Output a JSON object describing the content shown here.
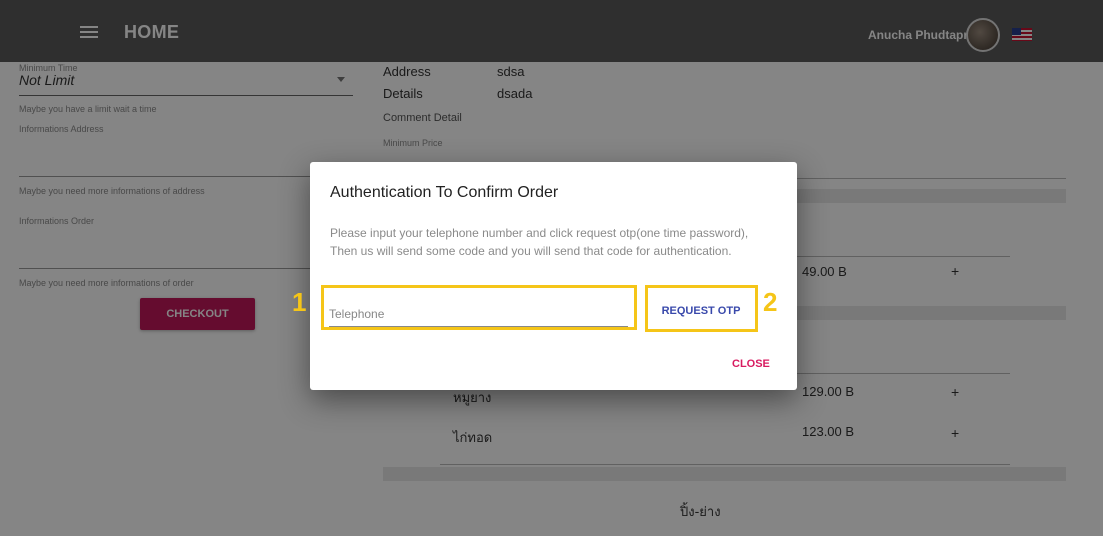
{
  "header": {
    "title": "HOME",
    "user_name": "Anucha Phudtapranee"
  },
  "form": {
    "min_time_label": "Minimum Time",
    "min_time_value": "Not Limit",
    "min_time_hint": "Maybe you have a limit wait a time",
    "address_label": "Informations Address",
    "address_hint": "Maybe you need more informations of address",
    "order_label": "Informations Order",
    "order_hint": "Maybe you need more informations of order",
    "checkout_label": "CHECKOUT"
  },
  "details": {
    "address_label": "Address",
    "address_value": "sdsa",
    "details_label": "Details",
    "details_value": "dsada",
    "comment_label": "Comment Detail",
    "min_price_label": "Minimum Price"
  },
  "menu": {
    "items": [
      {
        "name": "",
        "price": "49.00 B",
        "add": "+"
      },
      {
        "name": "หมูยาง",
        "price": "129.00 B",
        "add": "+"
      },
      {
        "name": "ไก่ทอด",
        "price": "123.00 B",
        "add": "+"
      }
    ],
    "category": "ปิ้ง-ย่าง"
  },
  "dialog": {
    "title": "Authentication To Confirm Order",
    "description": "Please input your telephone number and click request otp(one time password), Then us will send some code and you will send that code for authentication.",
    "telephone_placeholder": "Telephone",
    "request_otp_label": "REQUEST OTP",
    "close_label": "CLOSE"
  },
  "annotations": {
    "box1": "1",
    "box2": "2"
  },
  "colors": {
    "appbar": "#5a5a5a",
    "checkout": "#c2185b",
    "otp": "#3949ab",
    "close": "#d81b60",
    "highlight": "#f5c518"
  }
}
